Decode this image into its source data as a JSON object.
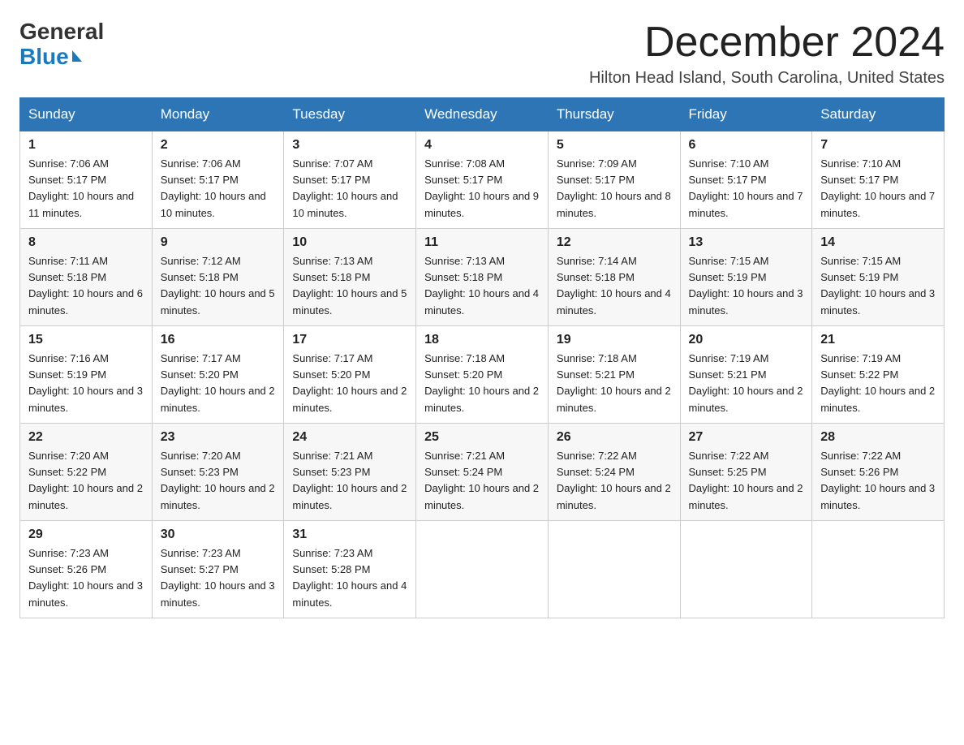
{
  "logo": {
    "line1": "General",
    "line2": "Blue"
  },
  "header": {
    "title": "December 2024",
    "location": "Hilton Head Island, South Carolina, United States"
  },
  "days_of_week": [
    "Sunday",
    "Monday",
    "Tuesday",
    "Wednesday",
    "Thursday",
    "Friday",
    "Saturday"
  ],
  "weeks": [
    [
      {
        "day": "1",
        "sunrise": "7:06 AM",
        "sunset": "5:17 PM",
        "daylight": "10 hours and 11 minutes."
      },
      {
        "day": "2",
        "sunrise": "7:06 AM",
        "sunset": "5:17 PM",
        "daylight": "10 hours and 10 minutes."
      },
      {
        "day": "3",
        "sunrise": "7:07 AM",
        "sunset": "5:17 PM",
        "daylight": "10 hours and 10 minutes."
      },
      {
        "day": "4",
        "sunrise": "7:08 AM",
        "sunset": "5:17 PM",
        "daylight": "10 hours and 9 minutes."
      },
      {
        "day": "5",
        "sunrise": "7:09 AM",
        "sunset": "5:17 PM",
        "daylight": "10 hours and 8 minutes."
      },
      {
        "day": "6",
        "sunrise": "7:10 AM",
        "sunset": "5:17 PM",
        "daylight": "10 hours and 7 minutes."
      },
      {
        "day": "7",
        "sunrise": "7:10 AM",
        "sunset": "5:17 PM",
        "daylight": "10 hours and 7 minutes."
      }
    ],
    [
      {
        "day": "8",
        "sunrise": "7:11 AM",
        "sunset": "5:18 PM",
        "daylight": "10 hours and 6 minutes."
      },
      {
        "day": "9",
        "sunrise": "7:12 AM",
        "sunset": "5:18 PM",
        "daylight": "10 hours and 5 minutes."
      },
      {
        "day": "10",
        "sunrise": "7:13 AM",
        "sunset": "5:18 PM",
        "daylight": "10 hours and 5 minutes."
      },
      {
        "day": "11",
        "sunrise": "7:13 AM",
        "sunset": "5:18 PM",
        "daylight": "10 hours and 4 minutes."
      },
      {
        "day": "12",
        "sunrise": "7:14 AM",
        "sunset": "5:18 PM",
        "daylight": "10 hours and 4 minutes."
      },
      {
        "day": "13",
        "sunrise": "7:15 AM",
        "sunset": "5:19 PM",
        "daylight": "10 hours and 3 minutes."
      },
      {
        "day": "14",
        "sunrise": "7:15 AM",
        "sunset": "5:19 PM",
        "daylight": "10 hours and 3 minutes."
      }
    ],
    [
      {
        "day": "15",
        "sunrise": "7:16 AM",
        "sunset": "5:19 PM",
        "daylight": "10 hours and 3 minutes."
      },
      {
        "day": "16",
        "sunrise": "7:17 AM",
        "sunset": "5:20 PM",
        "daylight": "10 hours and 2 minutes."
      },
      {
        "day": "17",
        "sunrise": "7:17 AM",
        "sunset": "5:20 PM",
        "daylight": "10 hours and 2 minutes."
      },
      {
        "day": "18",
        "sunrise": "7:18 AM",
        "sunset": "5:20 PM",
        "daylight": "10 hours and 2 minutes."
      },
      {
        "day": "19",
        "sunrise": "7:18 AM",
        "sunset": "5:21 PM",
        "daylight": "10 hours and 2 minutes."
      },
      {
        "day": "20",
        "sunrise": "7:19 AM",
        "sunset": "5:21 PM",
        "daylight": "10 hours and 2 minutes."
      },
      {
        "day": "21",
        "sunrise": "7:19 AM",
        "sunset": "5:22 PM",
        "daylight": "10 hours and 2 minutes."
      }
    ],
    [
      {
        "day": "22",
        "sunrise": "7:20 AM",
        "sunset": "5:22 PM",
        "daylight": "10 hours and 2 minutes."
      },
      {
        "day": "23",
        "sunrise": "7:20 AM",
        "sunset": "5:23 PM",
        "daylight": "10 hours and 2 minutes."
      },
      {
        "day": "24",
        "sunrise": "7:21 AM",
        "sunset": "5:23 PM",
        "daylight": "10 hours and 2 minutes."
      },
      {
        "day": "25",
        "sunrise": "7:21 AM",
        "sunset": "5:24 PM",
        "daylight": "10 hours and 2 minutes."
      },
      {
        "day": "26",
        "sunrise": "7:22 AM",
        "sunset": "5:24 PM",
        "daylight": "10 hours and 2 minutes."
      },
      {
        "day": "27",
        "sunrise": "7:22 AM",
        "sunset": "5:25 PM",
        "daylight": "10 hours and 2 minutes."
      },
      {
        "day": "28",
        "sunrise": "7:22 AM",
        "sunset": "5:26 PM",
        "daylight": "10 hours and 3 minutes."
      }
    ],
    [
      {
        "day": "29",
        "sunrise": "7:23 AM",
        "sunset": "5:26 PM",
        "daylight": "10 hours and 3 minutes."
      },
      {
        "day": "30",
        "sunrise": "7:23 AM",
        "sunset": "5:27 PM",
        "daylight": "10 hours and 3 minutes."
      },
      {
        "day": "31",
        "sunrise": "7:23 AM",
        "sunset": "5:28 PM",
        "daylight": "10 hours and 4 minutes."
      },
      null,
      null,
      null,
      null
    ]
  ]
}
